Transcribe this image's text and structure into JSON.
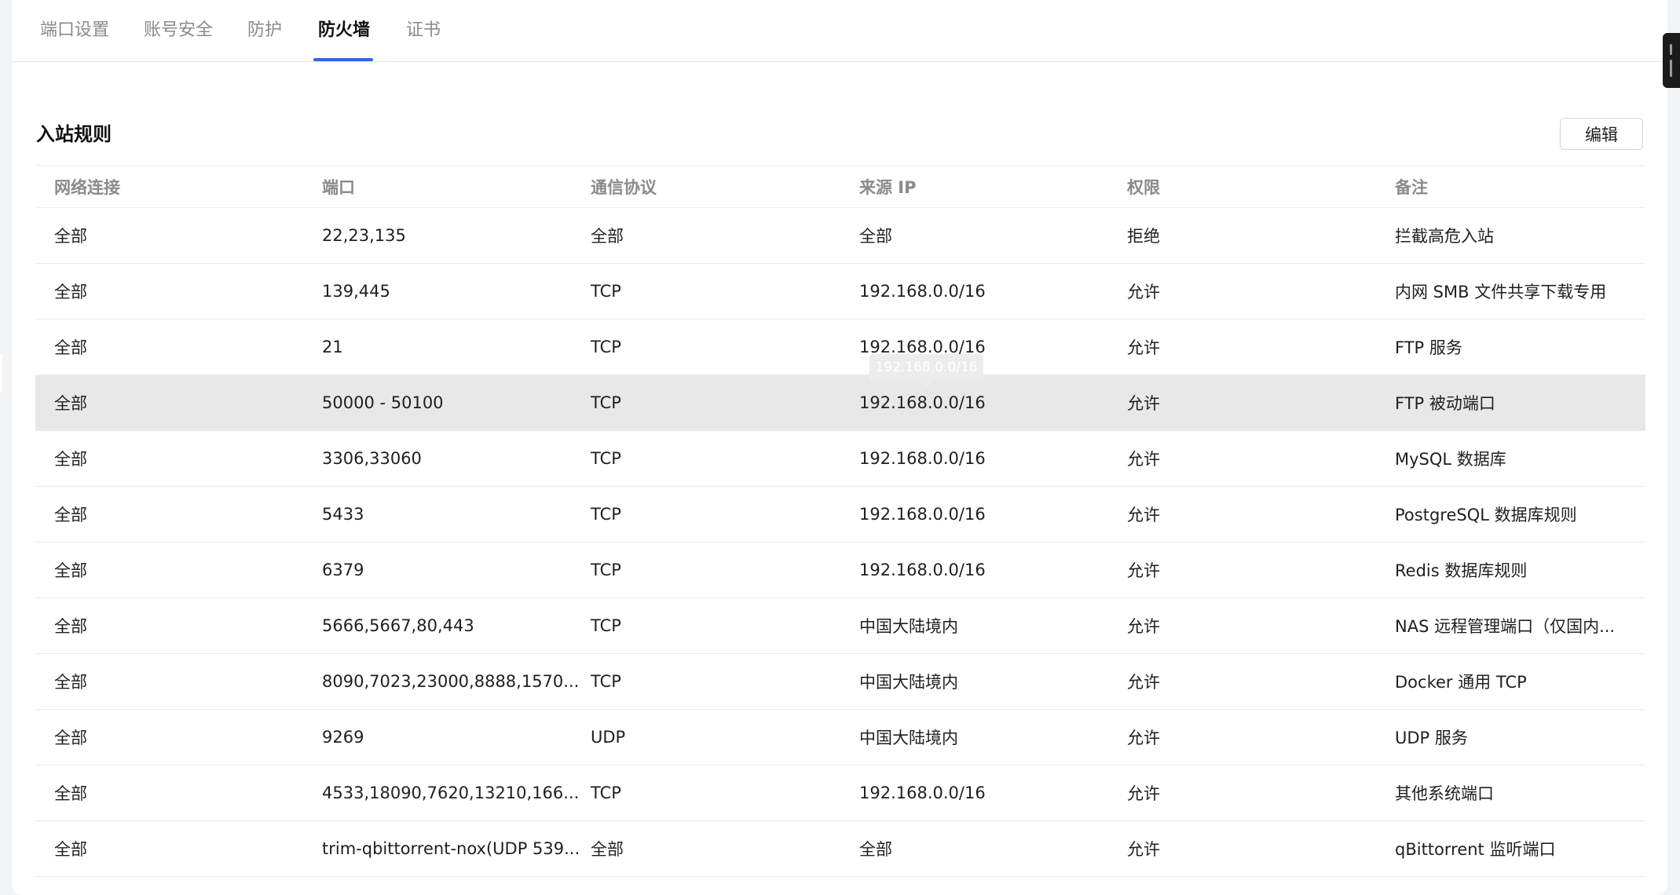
{
  "tabs": [
    {
      "label": "端口设置"
    },
    {
      "label": "账号安全"
    },
    {
      "label": "防护"
    },
    {
      "label": "防火墙"
    },
    {
      "label": "证书"
    }
  ],
  "active_tab": "防火墙",
  "section": {
    "title": "入站规则",
    "edit_label": "编辑"
  },
  "table": {
    "columns": [
      "网络连接",
      "端口",
      "通信协议",
      "来源 IP",
      "权限",
      "备注"
    ],
    "rows": [
      [
        "全部",
        "22,23,135",
        "全部",
        "全部",
        "拒绝",
        "拦截高危入站"
      ],
      [
        "全部",
        "139,445",
        "TCP",
        "192.168.0.0/16",
        "允许",
        "内网 SMB 文件共享下载专用"
      ],
      [
        "全部",
        "21",
        "TCP",
        "192.168.0.0/16",
        "允许",
        "FTP 服务"
      ],
      [
        "全部",
        "50000 - 50100",
        "TCP",
        "192.168.0.0/16",
        "允许",
        "FTP 被动端口"
      ],
      [
        "全部",
        "3306,33060",
        "TCP",
        "192.168.0.0/16",
        "允许",
        "MySQL 数据库"
      ],
      [
        "全部",
        "5433",
        "TCP",
        "192.168.0.0/16",
        "允许",
        "PostgreSQL 数据库规则"
      ],
      [
        "全部",
        "6379",
        "TCP",
        "192.168.0.0/16",
        "允许",
        "Redis 数据库规则"
      ],
      [
        "全部",
        "5666,5667,80,443",
        "TCP",
        "中国大陆境内",
        "允许",
        "NAS 远程管理端口（仅国内..."
      ],
      [
        "全部",
        "8090,7023,23000,8888,1570...",
        "TCP",
        "中国大陆境内",
        "允许",
        "Docker 通用 TCP"
      ],
      [
        "全部",
        "9269",
        "UDP",
        "中国大陆境内",
        "允许",
        "UDP 服务"
      ],
      [
        "全部",
        "4533,18090,7620,13210,166...",
        "TCP",
        "192.168.0.0/16",
        "允许",
        "其他系统端口"
      ],
      [
        "全部",
        "trim-qbittorrent-nox(UDP 539...",
        "全部",
        "全部",
        "允许",
        "qBittorrent 监听端口"
      ]
    ]
  },
  "hovered_row": 3,
  "tooltip": {
    "text": "192.168.0.0/16"
  },
  "colors": {
    "accent": "#2d6ae3",
    "hover_row": "#e8e8e8"
  }
}
